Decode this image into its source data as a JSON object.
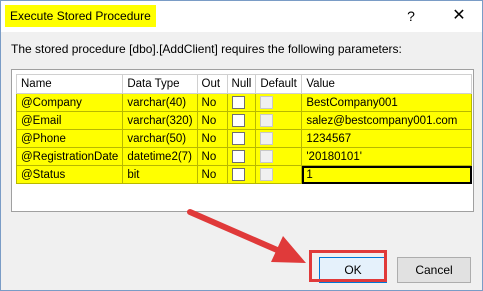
{
  "window": {
    "title": "Execute Stored Procedure",
    "help_glyph": "?",
    "close_glyph": "✕"
  },
  "description": "The stored procedure [dbo].[AddClient] requires the following parameters:",
  "table": {
    "headers": {
      "name": "Name",
      "data_type": "Data Type",
      "out": "Out",
      "null": "Null",
      "default": "Default",
      "value": "Value"
    },
    "rows": [
      {
        "name": "@Company",
        "data_type": "varchar(40)",
        "out": "No",
        "value": "BestCompany001"
      },
      {
        "name": "@Email",
        "data_type": "varchar(320)",
        "out": "No",
        "value": "salez@bestcompany001.com"
      },
      {
        "name": "@Phone",
        "data_type": "varchar(50)",
        "out": "No",
        "value": "1234567"
      },
      {
        "name": "@RegistrationDate",
        "data_type": "datetime2(7)",
        "out": "No",
        "value": "'20180101'"
      },
      {
        "name": "@Status",
        "data_type": "bit",
        "out": "No",
        "value": "1"
      }
    ]
  },
  "buttons": {
    "ok": "OK",
    "cancel": "Cancel"
  },
  "colors": {
    "highlight": "#ffff00",
    "annotation_red": "#e03a3a"
  }
}
